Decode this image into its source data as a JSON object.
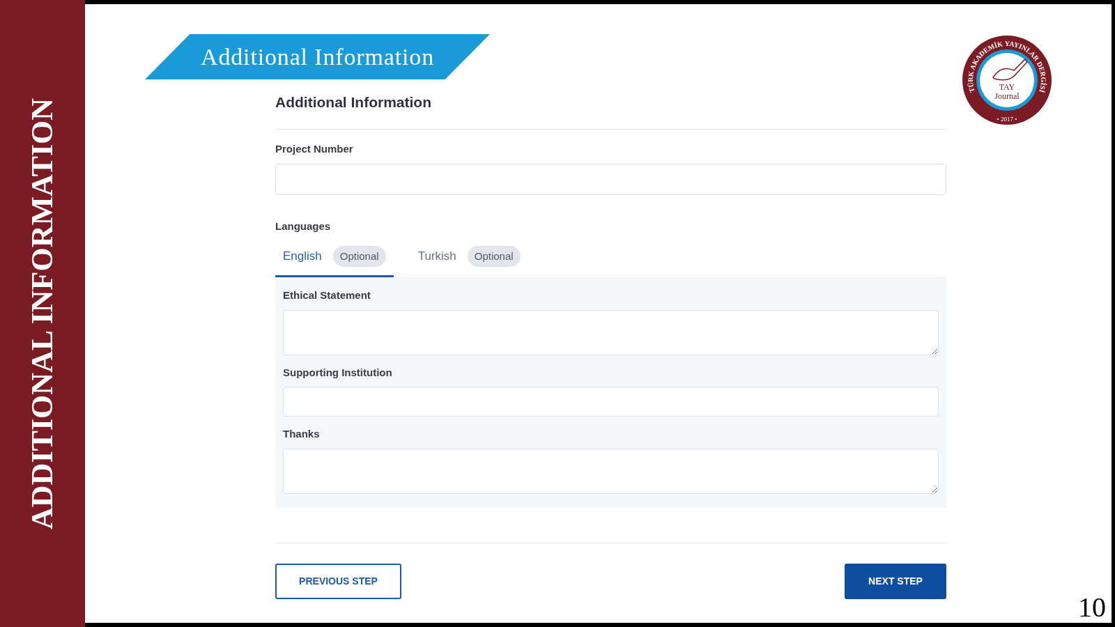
{
  "side_title": "ADDITIONAL INFORMATION",
  "banner": "Additional Information",
  "logo": {
    "ring_text": "TÜRK AKADEMİK YAYINLAR DERGİSİ",
    "name_top": "TAY",
    "name_bottom": "Journal",
    "year": "• 2017 •"
  },
  "form": {
    "title": "Additional Information",
    "project_number": {
      "label": "Project Number"
    },
    "languages": {
      "label": "Languages",
      "tabs": [
        {
          "label": "English",
          "badge": "Optional",
          "selected": true
        },
        {
          "label": "Turkish",
          "badge": "Optional",
          "selected": false
        }
      ],
      "fields": [
        {
          "label": "Ethical Statement",
          "kind": "textarea"
        },
        {
          "label": "Supporting Institution",
          "kind": "input"
        },
        {
          "label": "Thanks",
          "kind": "textarea"
        }
      ]
    },
    "buttons": [
      {
        "label": "PREVIOUS STEP",
        "kind": "outline"
      },
      {
        "label": "NEXT STEP",
        "kind": "primary"
      }
    ]
  },
  "page_number": "10"
}
